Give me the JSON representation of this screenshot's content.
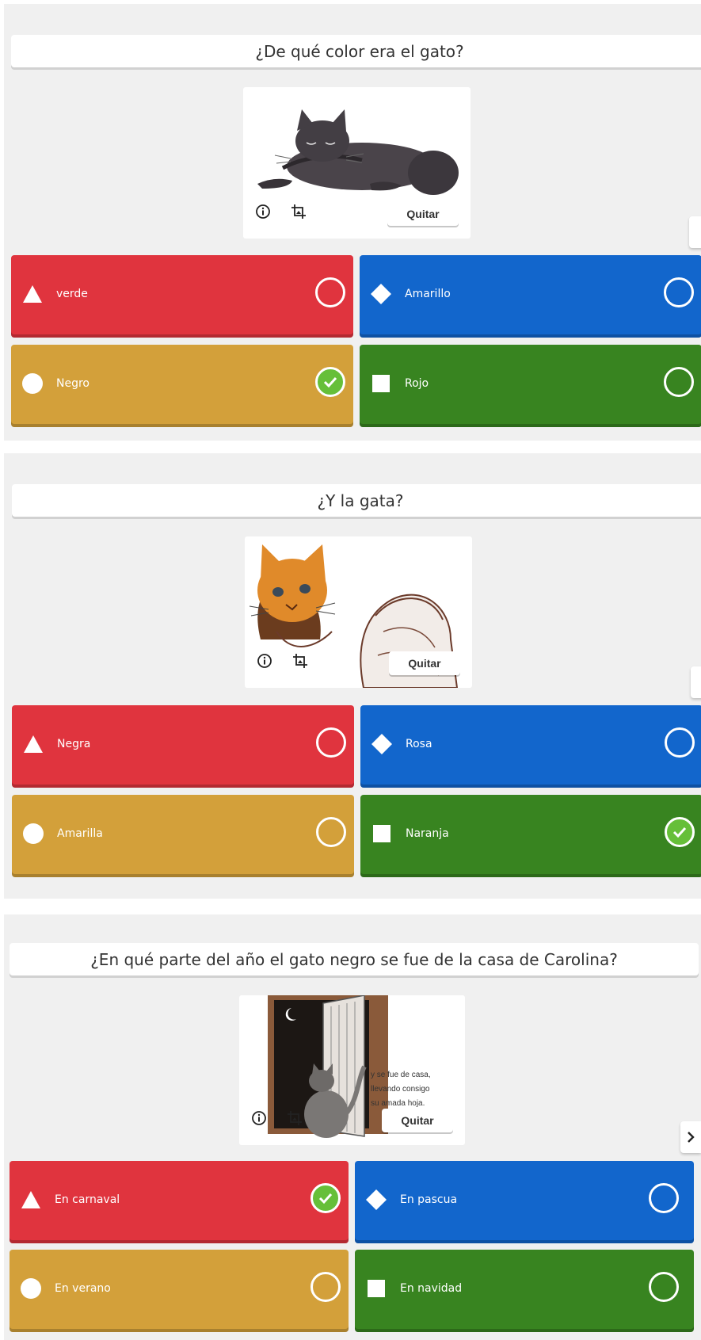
{
  "quitar_label": "Quitar",
  "questions": [
    {
      "text": "¿De qué color era el gato?",
      "answers": [
        {
          "label": "verde",
          "correct": false
        },
        {
          "label": "Amarillo",
          "correct": false
        },
        {
          "label": "Negro",
          "correct": true
        },
        {
          "label": "Rojo",
          "correct": false
        }
      ]
    },
    {
      "text": "¿Y la gata?",
      "answers": [
        {
          "label": "Negra",
          "correct": false
        },
        {
          "label": "Rosa",
          "correct": false
        },
        {
          "label": "Amarilla",
          "correct": false
        },
        {
          "label": "Naranja",
          "correct": true
        }
      ]
    },
    {
      "text": "¿En qué parte del año el gato negro se fue de la casa de Carolina?",
      "image_caption": [
        "y se fue de casa,",
        "llevando consigo",
        "su amada hoja."
      ],
      "answers": [
        {
          "label": "En carnaval",
          "correct": true
        },
        {
          "label": "En pascua",
          "correct": false
        },
        {
          "label": "En verano",
          "correct": false
        },
        {
          "label": "En navidad",
          "correct": false
        }
      ]
    }
  ],
  "answer_colors": {
    "red": "#e0343e",
    "blue": "#1266cc",
    "yellow": "#d3a03a",
    "green": "#388420"
  },
  "answer_shapes": [
    "triangle-icon",
    "diamond-icon",
    "circle-icon",
    "square-icon"
  ],
  "correct_color": "#66bf39"
}
